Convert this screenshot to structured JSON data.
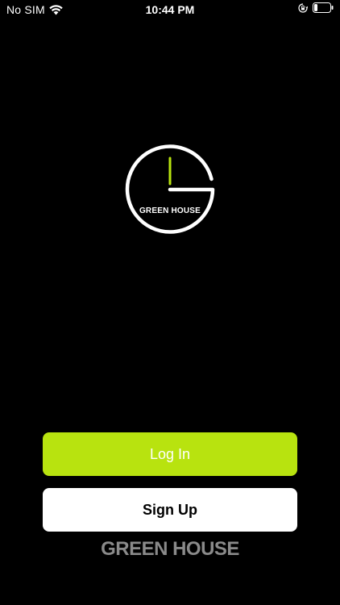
{
  "status_bar": {
    "carrier": "No SIM",
    "time": "10:44 PM",
    "icons": [
      "wifi-icon",
      "orientation-lock-icon",
      "battery-icon"
    ]
  },
  "logo": {
    "text": "GREEN HOUSE",
    "ring_color": "#ffffff",
    "hand_color": "#b8e30f"
  },
  "buttons": {
    "login_label": "Log In",
    "signup_label": "Sign Up"
  },
  "footer": {
    "brand_text": "GREEN HOUSE"
  },
  "colors": {
    "background": "#000000",
    "accent": "#b8e30f",
    "signup_bg": "#ffffff",
    "footer_text": "#8a8a8a"
  }
}
